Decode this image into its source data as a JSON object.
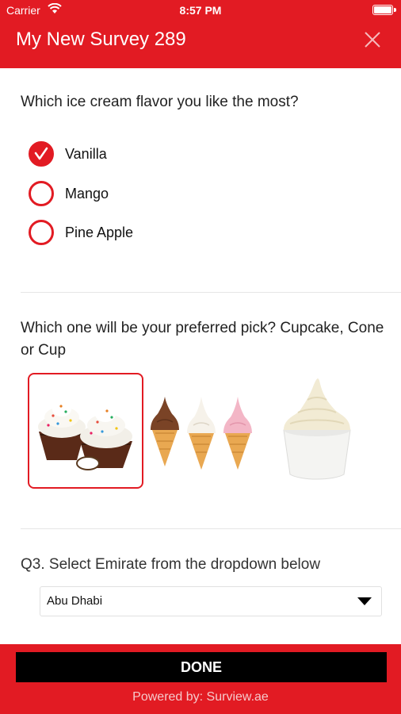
{
  "status_bar": {
    "carrier": "Carrier",
    "time": "8:57 PM"
  },
  "header": {
    "title": "My New Survey 289"
  },
  "question1": {
    "text": "Which ice cream flavor you like the most?",
    "options": [
      {
        "label": "Vanilla",
        "selected": true
      },
      {
        "label": "Mango",
        "selected": false
      },
      {
        "label": "Pine Apple",
        "selected": false
      }
    ]
  },
  "question2": {
    "text": "Which one will be your preferred pick? Cupcake, Cone or Cup",
    "choices": [
      {
        "name": "cupcake",
        "selected": true
      },
      {
        "name": "cone",
        "selected": false
      },
      {
        "name": "cup",
        "selected": false
      }
    ]
  },
  "question3": {
    "text": "Q3. Select Emirate from the dropdown below",
    "selected_value": "Abu Dhabi"
  },
  "footer": {
    "done_label": "DONE",
    "powered_by": "Powered by: Surview.ae"
  },
  "colors": {
    "accent": "#e21b23",
    "button": "#000000"
  }
}
